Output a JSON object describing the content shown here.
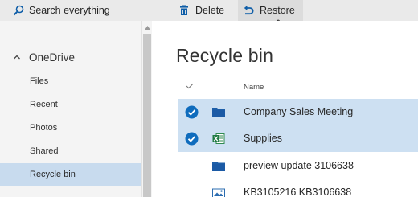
{
  "toolbar": {
    "search_placeholder": "Search everything",
    "delete_label": "Delete",
    "restore_label": "Restore"
  },
  "sidebar": {
    "root_label": "OneDrive",
    "items": [
      {
        "label": "Files"
      },
      {
        "label": "Recent"
      },
      {
        "label": "Photos"
      },
      {
        "label": "Shared"
      },
      {
        "label": "Recycle bin",
        "selected": true
      }
    ]
  },
  "main": {
    "title": "Recycle bin",
    "column_name": "Name",
    "rows": [
      {
        "name": "Company Sales Meeting",
        "type": "folder-icon",
        "selected": true
      },
      {
        "name": "Supplies",
        "type": "excel-file-icon",
        "selected": true
      },
      {
        "name": "preview update 3106638",
        "type": "folder-icon",
        "selected": false
      },
      {
        "name": "KB3105216 KB3106638",
        "type": "image-file-icon",
        "selected": false
      }
    ]
  },
  "colors": {
    "accent": "#0078d7",
    "selected_row": "#cde0f2",
    "toolbar_bg": "#eaeaea",
    "sidebar_bg": "#f4f4f4"
  }
}
